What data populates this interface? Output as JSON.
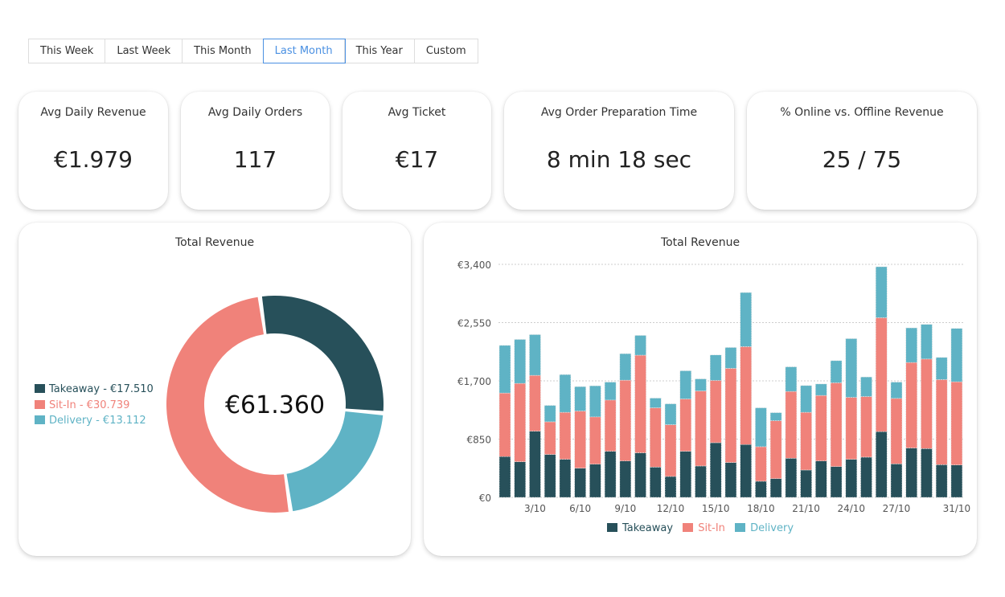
{
  "filters": {
    "options": [
      "This Week",
      "Last Week",
      "This Month",
      "Last Month",
      "This Year",
      "Custom"
    ],
    "selected": "Last Month"
  },
  "kpis": [
    {
      "title": "Avg Daily Revenue",
      "value": "€1.979"
    },
    {
      "title": "Avg Daily Orders",
      "value": "117"
    },
    {
      "title": "Avg Ticket",
      "value": "€17"
    },
    {
      "title": "Avg Order Preparation Time",
      "value": "8 min 18 sec"
    },
    {
      "title": "% Online vs. Offline Revenue",
      "value": "25 / 75"
    }
  ],
  "colors": {
    "takeaway": "#27505a",
    "sitin": "#f0827a",
    "delivery": "#5fb3c5",
    "accent": "#4a90e2"
  },
  "donut": {
    "title": "Total Revenue",
    "center_label": "€61.360",
    "legend": [
      "Takeaway - €17.510",
      "Sit-In - €30.739",
      "Delivery - €13.112"
    ]
  },
  "chart_data": [
    {
      "type": "pie",
      "title": "Total Revenue",
      "categories": [
        "Takeaway",
        "Sit-In",
        "Delivery"
      ],
      "values": [
        17510,
        30739,
        13112
      ],
      "total": 61360,
      "donut": true,
      "legend": "left"
    },
    {
      "type": "bar",
      "stacked": true,
      "title": "Total Revenue",
      "legend": "bottom",
      "categories": [
        "1/10",
        "2/10",
        "3/10",
        "4/10",
        "5/10",
        "6/10",
        "7/10",
        "8/10",
        "9/10",
        "10/10",
        "11/10",
        "12/10",
        "13/10",
        "14/10",
        "15/10",
        "16/10",
        "17/10",
        "18/10",
        "19/10",
        "20/10",
        "21/10",
        "22/10",
        "23/10",
        "24/10",
        "25/10",
        "26/10",
        "27/10",
        "28/10",
        "29/10",
        "30/10",
        "31/10"
      ],
      "x_tick_labels": [
        "3/10",
        "6/10",
        "9/10",
        "12/10",
        "15/10",
        "18/10",
        "21/10",
        "24/10",
        "27/10",
        "31/10"
      ],
      "y_tick_labels": [
        "€0",
        "€850",
        "€1,700",
        "€2,550",
        "€3,400"
      ],
      "ylim": [
        0,
        3400
      ],
      "grid": true,
      "series": [
        {
          "name": "Takeaway",
          "values": [
            595,
            520,
            966,
            626,
            556,
            426,
            485,
            673,
            532,
            650,
            442,
            305,
            673,
            458,
            798,
            509,
            771,
            235,
            274,
            571,
            399,
            532,
            450,
            556,
            587,
            959,
            489,
            720,
            712,
            477,
            473
          ]
        },
        {
          "name": "Sit-In",
          "values": [
            927,
            1143,
            814,
            477,
            684,
            834,
            689,
            747,
            1178,
            1424,
            865,
            755,
            763,
            1095,
            908,
            1373,
            1428,
            504,
            845,
            974,
            841,
            955,
            1221,
            903,
            884,
            1662,
            955,
            1248,
            1307,
            1241,
            1213
          ]
        },
        {
          "name": "Delivery",
          "values": [
            696,
            641,
            595,
            239,
            552,
            356,
            454,
            262,
            387,
            289,
            141,
            305,
            411,
            176,
            372,
            305,
            790,
            568,
            117,
            360,
            392,
            168,
            324,
            857,
            286,
            744,
            238,
            505,
            505,
            324,
            779
          ]
        }
      ]
    }
  ]
}
